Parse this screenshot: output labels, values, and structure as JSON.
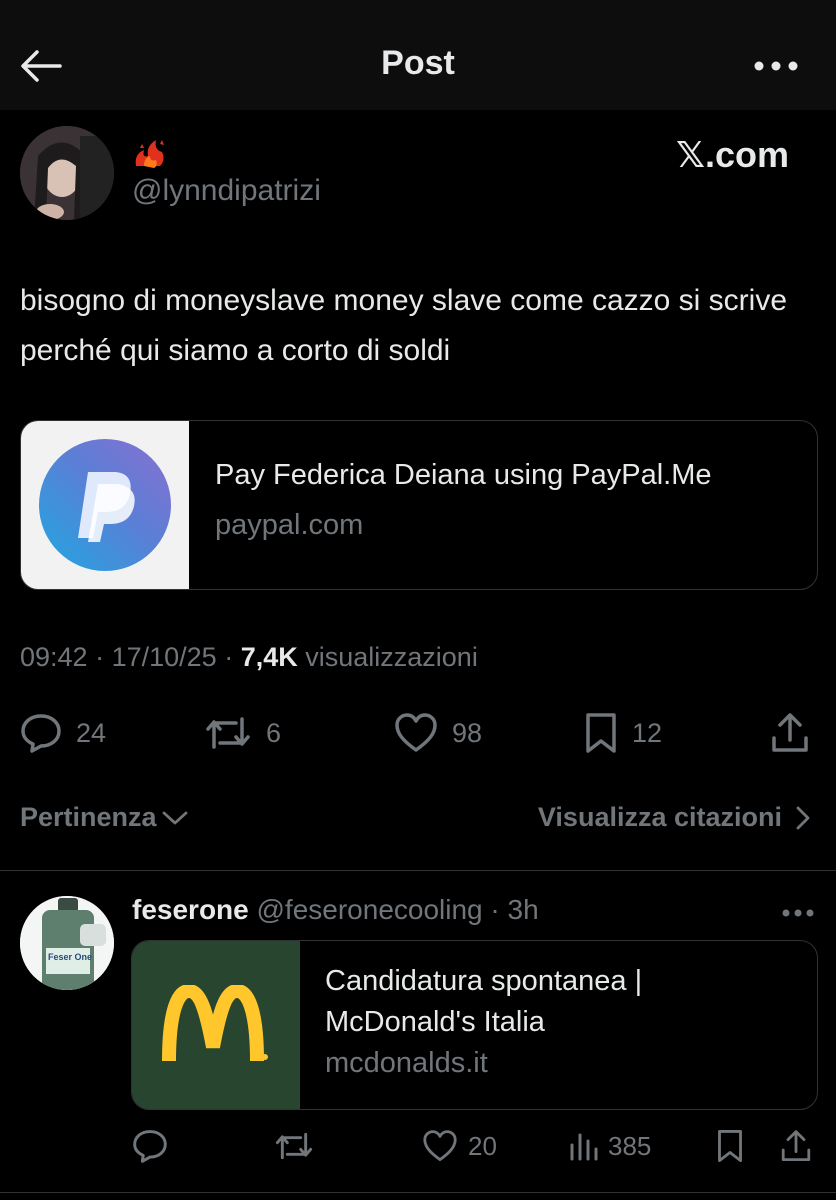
{
  "header": {
    "title": "Post"
  },
  "post": {
    "author_handle": "@lynndipatrizi",
    "brand_label": "𝕏.com",
    "text": "bisogno di moneyslave money slave come cazzo si scrive perché qui siamo a corto di soldi",
    "link_card": {
      "title": "Pay Federica Deiana using PayPal.Me",
      "domain": "paypal.com"
    },
    "time": "09:42",
    "date": "17/10/25",
    "views_count": "7,4K",
    "views_label": "visualizzazioni",
    "actions": {
      "replies": "24",
      "reposts": "6",
      "likes": "98",
      "bookmarks": "12"
    }
  },
  "sort": {
    "label": "Pertinenza",
    "quotes_label": "Visualizza citazioni"
  },
  "reply": {
    "name": "feserone",
    "handle": "@feseronecooling",
    "age": "3h",
    "link_card": {
      "title": "Candidatura spontanea | McDonald's Italia",
      "domain": "mcdonalds.it"
    },
    "avatar_text": "Feser One",
    "actions": {
      "likes": "20",
      "views": "385"
    }
  },
  "colors": {
    "background": "#000000",
    "text": "#e7e9ea",
    "muted": "#71767b",
    "border": "#2f3336",
    "mcdonalds_green": "#27452f",
    "mcdonalds_yellow": "#ffc72c"
  },
  "icons": [
    "back-arrow-icon",
    "more-icon",
    "fire-emoji-icon",
    "paypal-logo-icon",
    "reply-icon",
    "repost-icon",
    "like-icon",
    "bookmark-icon",
    "share-icon",
    "chevron-down-icon",
    "chevron-right-icon",
    "views-icon",
    "mcdonalds-logo-icon"
  ]
}
